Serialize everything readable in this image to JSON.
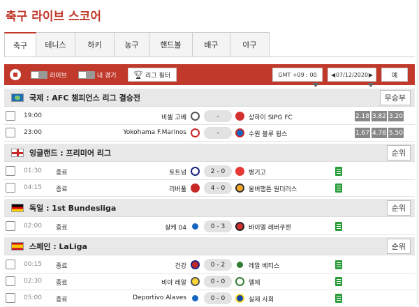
{
  "title": "축구 라이브 스코어",
  "tabs": [
    "축구",
    "테니스",
    "하키",
    "농구",
    "핸드볼",
    "배구",
    "야구"
  ],
  "toolbar": {
    "live_label": "라이브",
    "my_games_label": "내 경기",
    "league_filter_label": "리그 필터",
    "timezone": "GMT +09 : 00",
    "date": "07/12/2020",
    "lang": "예"
  },
  "leagues": [
    {
      "name": "국제 : AFC 챔피언스 리그 결승전",
      "button": "무승부",
      "flag": "world",
      "matches": [
        {
          "time": "19:00",
          "status": "",
          "home": "비셀 고베",
          "score": "-",
          "away": "상하이 SIPG FC",
          "odds": [
            "2.18",
            "3.82",
            "3.20"
          ]
        },
        {
          "time": "23:00",
          "status": "",
          "home": "Yokohama F.Marinos",
          "score": "-",
          "away": "수원 블루 윙스",
          "odds": [
            "1.67",
            "4.78",
            "5.50"
          ]
        }
      ]
    },
    {
      "name": "잉글랜드 : 프리미어 리그",
      "button": "순위",
      "flag": "england",
      "matches": [
        {
          "time": "01:30",
          "status": "종료",
          "home": "토트넘",
          "score": "2 - 0",
          "away": "병기고"
        },
        {
          "time": "04:15",
          "status": "종료",
          "home": "리버풀",
          "score": "4 - 0",
          "away": "울버햄튼 원더러스"
        }
      ]
    },
    {
      "name": "독일 : 1st Bundesliga",
      "button": "순위",
      "flag": "germany",
      "matches": [
        {
          "time": "02:00",
          "status": "종료",
          "home": "샬케 04",
          "score": "0 - 3",
          "away": "바이엘 레버쿠젠"
        }
      ]
    },
    {
      "name": "스페인 : LaLiga",
      "button": "순위",
      "flag": "spain",
      "matches": [
        {
          "time": "00:15",
          "status": "종료",
          "home": "건강",
          "score": "0 - 2",
          "away": "레알 베티스"
        },
        {
          "time": "02:30",
          "status": "종료",
          "home": "비야 레알",
          "score": "0 - 0",
          "away": "엘체"
        },
        {
          "time": "05:00",
          "status": "종료",
          "home": "Deportivo Alaves",
          "score": "0 - 0",
          "away": "실제 사회"
        }
      ]
    }
  ],
  "colors": {
    "accent": "#c0392b",
    "odds_bg": "#888888",
    "doc_icon": "#2a9d3a"
  }
}
